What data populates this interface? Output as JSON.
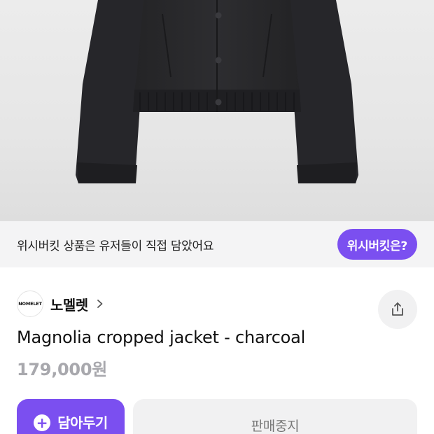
{
  "banner": {
    "text": "위시버킷 상품은 유저들이 직접 담았어요",
    "button_label": "위시버킷은?"
  },
  "brand": {
    "logo_text": "NOMELET",
    "name": "노멜렛"
  },
  "product": {
    "title": "Magnolia cropped jacket - charcoal",
    "price": "179,000원",
    "image_icon": "jacket-photo"
  },
  "actions": {
    "add_label": "담아두기",
    "add_icon": "plus-icon",
    "status_label": "판매중지",
    "share_icon": "share-icon"
  },
  "colors": {
    "accent": "#7b4ff0",
    "price_gray": "#a8a8ad",
    "banner_bg": "#f4f4f5"
  }
}
